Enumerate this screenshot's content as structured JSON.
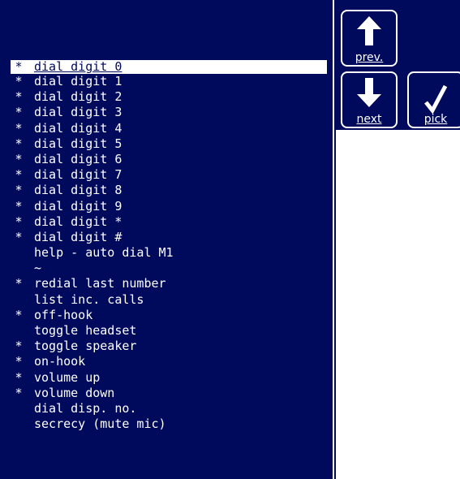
{
  "list": {
    "items": [
      {
        "star": "*",
        "label": "dial digit 0",
        "selected": true
      },
      {
        "star": "*",
        "label": "dial digit 1"
      },
      {
        "star": "*",
        "label": "dial digit 2"
      },
      {
        "star": "*",
        "label": "dial digit 3"
      },
      {
        "star": "*",
        "label": "dial digit 4"
      },
      {
        "star": "*",
        "label": "dial digit 5"
      },
      {
        "star": "*",
        "label": "dial digit 6"
      },
      {
        "star": "*",
        "label": "dial digit 7"
      },
      {
        "star": "*",
        "label": "dial digit 8"
      },
      {
        "star": "*",
        "label": "dial digit 9"
      },
      {
        "star": "*",
        "label": "dial digit *"
      },
      {
        "star": "*",
        "label": "dial digit #"
      },
      {
        "star": "",
        "label": "help - auto dial M1"
      },
      {
        "star": "",
        "label": "~"
      },
      {
        "star": "*",
        "label": "redial last number"
      },
      {
        "star": "",
        "label": "list inc. calls"
      },
      {
        "star": "*",
        "label": "off-hook"
      },
      {
        "star": "",
        "label": "toggle headset"
      },
      {
        "star": "*",
        "label": "toggle speaker"
      },
      {
        "star": "*",
        "label": "on-hook"
      },
      {
        "star": "*",
        "label": "volume up"
      },
      {
        "star": "*",
        "label": "volume down"
      },
      {
        "star": "",
        "label": "dial disp. no."
      },
      {
        "star": "",
        "label": "secrecy (mute mic)"
      }
    ]
  },
  "buttons": {
    "prev": "prev.",
    "next": "next",
    "pick": "pick"
  },
  "colors": {
    "background": "#000a5c",
    "foreground": "#ffffff"
  },
  "icons": {
    "prev": "up-arrow-icon",
    "next": "down-arrow-icon",
    "pick": "checkmark-icon"
  }
}
